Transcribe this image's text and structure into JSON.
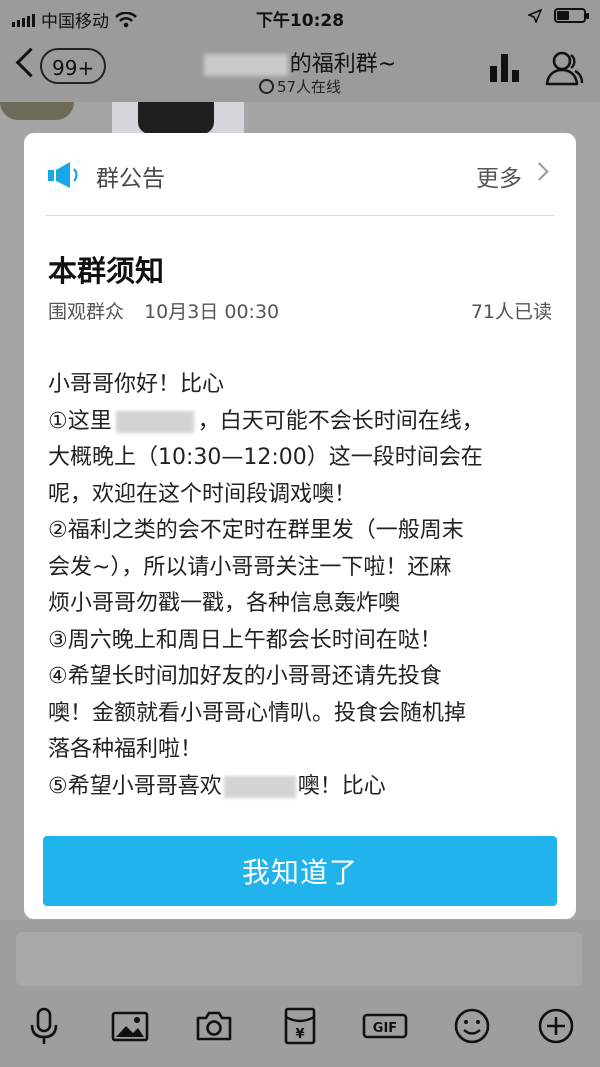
{
  "status_bar": {
    "carrier": "中国移动",
    "time": "下午10:28"
  },
  "nav": {
    "unread_count": "99+",
    "title_suffix": "的福利群~",
    "online": "57人在线"
  },
  "notice": {
    "header_label": "群公告",
    "more_label": "更多",
    "title": "本群须知",
    "author": "围观群众",
    "date": "10月3日 00:30",
    "read_count": "71人已读",
    "body": {
      "line1": "小哥哥你好！比心",
      "line2_a": "①这里",
      "line2_b": "，白天可能不会长时间在线，",
      "line3": "大概晚上（10:30—12:00）这一段时间会在",
      "line4": "呢，欢迎在这个时间段调戏噢！",
      "line5": "②福利之类的会不定时在群里发（一般周末",
      "line6": "会发~），所以请小哥哥关注一下啦！还麻",
      "line7": "烦小哥哥勿戳一戳，各种信息轰炸噢",
      "line8": "③周六晚上和周日上午都会长时间在哒！",
      "line9": "④希望长时间加好友的小哥哥还请先投食",
      "line10": "噢！金额就看小哥哥心情叭。投食会随机掉",
      "line11": "落各种福利啦！",
      "line12_a": "⑤希望小哥哥喜欢",
      "line12_b": "噢！比心"
    },
    "button_label": "我知道了"
  },
  "colors": {
    "accent": "#20b3ec",
    "megaphone": "#1aa6e6"
  },
  "toolbar_icons": [
    "microphone-icon",
    "image-icon",
    "camera-icon",
    "red-packet-icon",
    "gif-icon",
    "emoji-icon",
    "plus-icon"
  ]
}
